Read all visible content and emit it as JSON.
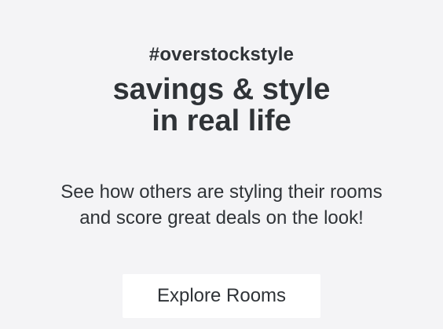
{
  "promo": {
    "hashtag": "#overstockstyle",
    "headline_line1": "savings & style",
    "headline_line2": "in real life",
    "subtext_line1": "See how others are styling their rooms",
    "subtext_line2": "and score great deals on the look!",
    "cta_label": "Explore Rooms"
  },
  "colors": {
    "background": "#f4f4f6",
    "text": "#2f3337",
    "button_background": "#ffffff"
  }
}
